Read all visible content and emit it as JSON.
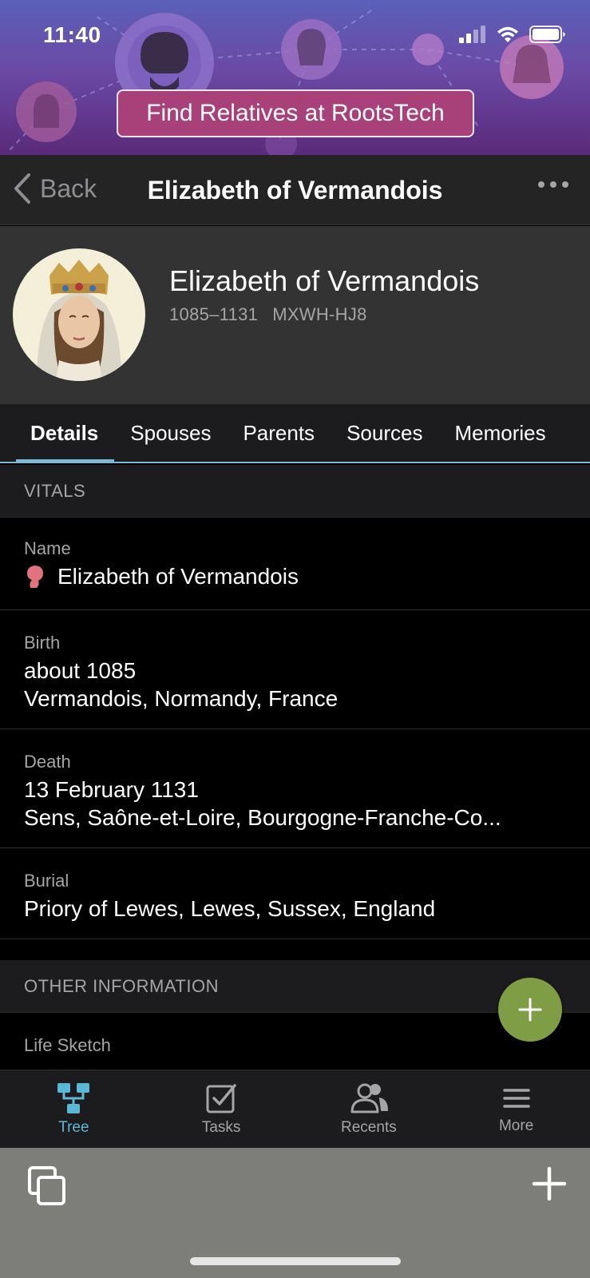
{
  "status_bar": {
    "time": "11:40"
  },
  "banner": {
    "button_label": "Find Relatives at RootsTech"
  },
  "navbar": {
    "back_label": "Back",
    "title": "Elizabeth of Vermandois"
  },
  "profile": {
    "name": "Elizabeth of Vermandois",
    "lifespan": "1085–1131",
    "id": "MXWH-HJ8"
  },
  "tabs": [
    "Details",
    "Spouses",
    "Parents",
    "Sources",
    "Memories"
  ],
  "vitals": {
    "header": "VITALS",
    "name_label": "Name",
    "name_value": "Elizabeth of Vermandois",
    "birth_label": "Birth",
    "birth_date": "about 1085",
    "birth_place": "Vermandois, Normandy, France",
    "death_label": "Death",
    "death_date": "13 February 1131",
    "death_place": "Sens, Saône-et-Loire, Bourgogne-Franche-Co...",
    "burial_label": "Burial",
    "burial_place": "Priory of Lewes, Lewes, Sussex, England"
  },
  "other": {
    "header": "OTHER INFORMATION",
    "life_sketch_label": "Life Sketch"
  },
  "tabbar": [
    {
      "label": "Tree",
      "icon": "tree-icon"
    },
    {
      "label": "Tasks",
      "icon": "tasks-icon"
    },
    {
      "label": "Recents",
      "icon": "recents-icon"
    },
    {
      "label": "More",
      "icon": "menu-icon"
    }
  ],
  "colors": {
    "accent": "#5bb8d4",
    "fab": "#7f9d45",
    "banner_button": "#a8417a",
    "female_icon": "#e0737d"
  }
}
